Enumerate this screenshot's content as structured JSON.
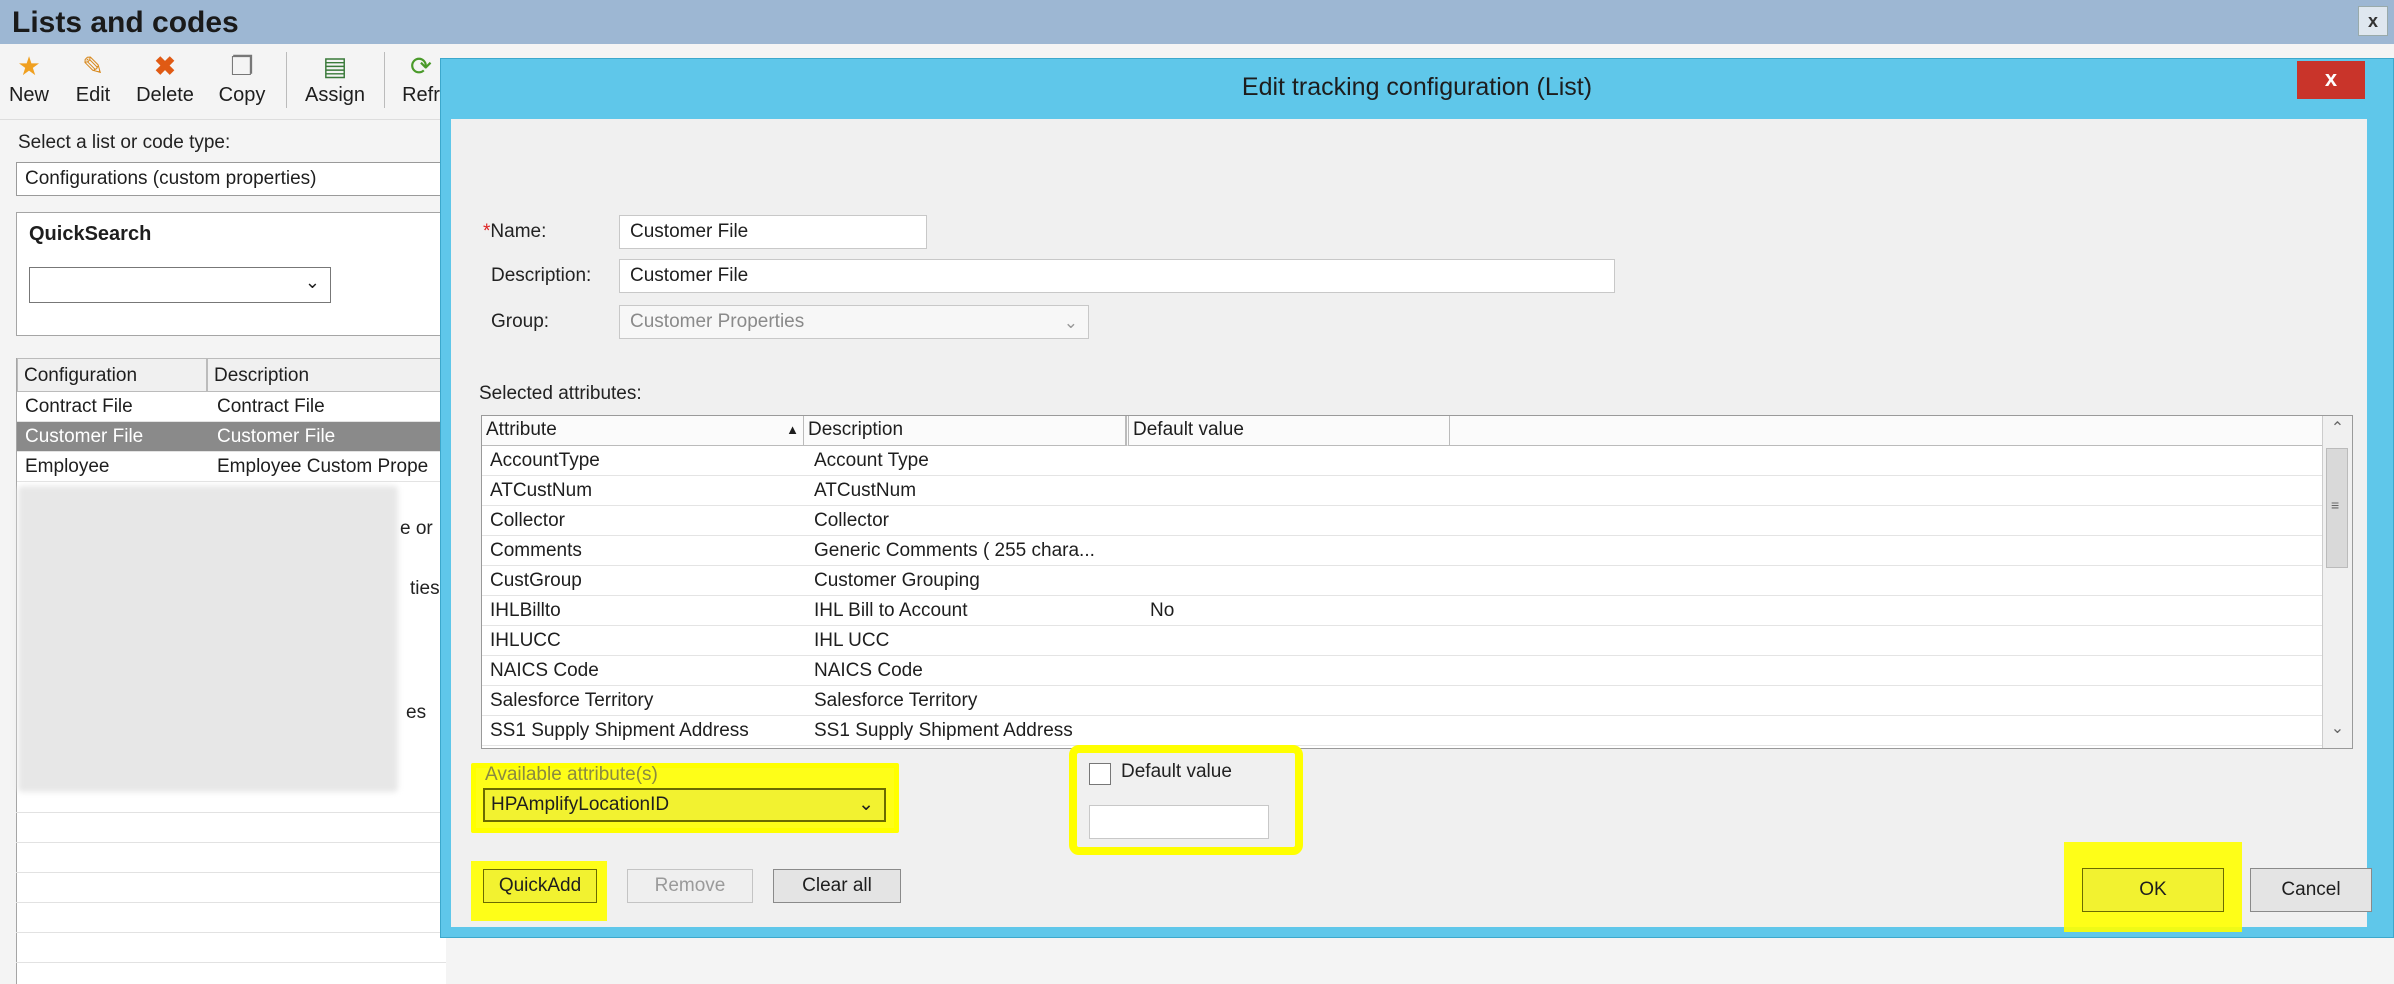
{
  "window": {
    "title": "Lists and codes",
    "close_label": "x"
  },
  "toolbar": {
    "new": "New",
    "edit": "Edit",
    "delete": "Delete",
    "copy": "Copy",
    "assign": "Assign",
    "refresh_partial": "Refr"
  },
  "list_type": {
    "label": "Select a list or code type:",
    "value": "Configurations (custom properties)"
  },
  "quicksearch": {
    "title": "QuickSearch",
    "value": ""
  },
  "bg_grid": {
    "headers": [
      "Configuration",
      "Description"
    ],
    "rows": [
      {
        "config": "Contract File",
        "description": "Contract File"
      },
      {
        "config": "Customer File",
        "description": "Customer File"
      },
      {
        "config": "Employee",
        "description": "Employee Custom Prope"
      }
    ],
    "partial_fragments": [
      "e or",
      "ties",
      "es"
    ]
  },
  "dialog": {
    "title": "Edit tracking configuration (List)",
    "close_label": "x",
    "name_label": "Name:",
    "required_mark": "*",
    "name_value": "Customer File",
    "description_label": "Description:",
    "description_value": "Customer File",
    "group_label": "Group:",
    "group_value": "Customer Properties",
    "selected_attributes_label": "Selected attributes:",
    "grid": {
      "headers": [
        "Attribute",
        "Description",
        "Default value"
      ],
      "rows": [
        {
          "attribute": "AccountType",
          "description": "Account Type",
          "default": ""
        },
        {
          "attribute": "ATCustNum",
          "description": "ATCustNum",
          "default": ""
        },
        {
          "attribute": "Collector",
          "description": "Collector",
          "default": ""
        },
        {
          "attribute": "Comments",
          "description": "Generic Comments ( 255 chara...",
          "default": ""
        },
        {
          "attribute": "CustGroup",
          "description": "Customer Grouping",
          "default": ""
        },
        {
          "attribute": "IHLBillto",
          "description": "IHL Bill to Account",
          "default": "No"
        },
        {
          "attribute": "IHLUCC",
          "description": "IHL UCC",
          "default": ""
        },
        {
          "attribute": "NAICS Code",
          "description": "NAICS Code",
          "default": ""
        },
        {
          "attribute": "Salesforce Territory",
          "description": "Salesforce Territory",
          "default": ""
        },
        {
          "attribute": "SS1 Supply Shipment Address",
          "description": "SS1 Supply Shipment Address",
          "default": ""
        }
      ]
    },
    "available_label": "Available attribute(s)",
    "available_value": "HPAmplifyLocationID",
    "default_value_label": "Default value",
    "default_value_checked": false,
    "quickadd_label": "QuickAdd",
    "remove_label": "Remove",
    "clear_all_label": "Clear all",
    "ok_label": "OK",
    "cancel_label": "Cancel",
    "highlight_color": "#ffff00"
  }
}
